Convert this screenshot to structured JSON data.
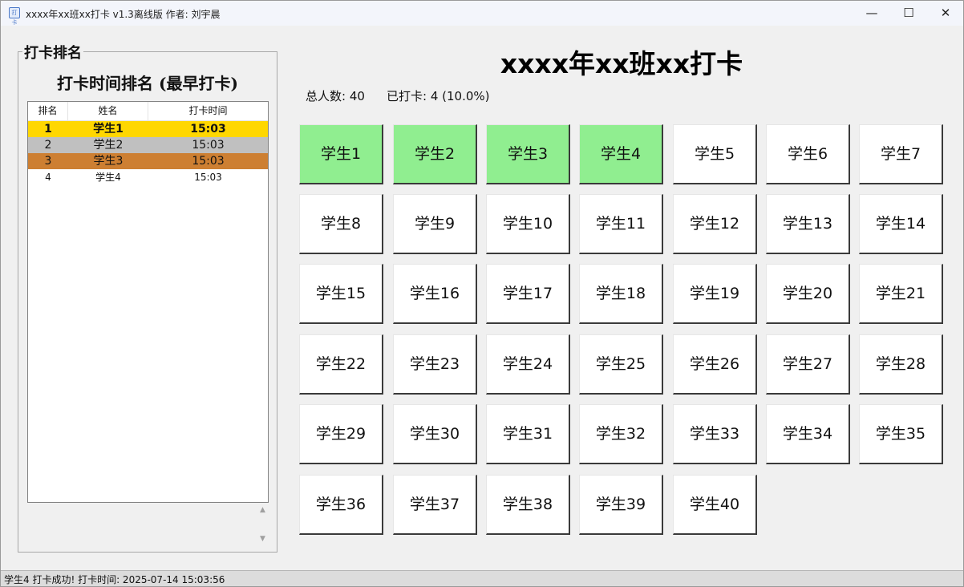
{
  "window": {
    "title": "xxxx年xx班xx打卡 v1.3离线版 作者: 刘宇晨",
    "icon_text": "打卡",
    "min_glyph": "—",
    "max_glyph": "☐",
    "close_glyph": "✕"
  },
  "ranking": {
    "group_label": "打卡排名",
    "title": "打卡时间排名 (最早打卡)",
    "headers": [
      "排名",
      "姓名",
      "打卡时间"
    ],
    "rows": [
      {
        "rank": "1",
        "name": "学生1",
        "time": "15:03",
        "color": "#ffd700"
      },
      {
        "rank": "2",
        "name": "学生2",
        "time": "15:03",
        "color": "#c0c0c0"
      },
      {
        "rank": "3",
        "name": "学生3",
        "time": "15:03",
        "color": "#cd7f32"
      },
      {
        "rank": "4",
        "name": "学生4",
        "time": "15:03",
        "color": "#ffffff"
      }
    ],
    "scroll_up": "▲",
    "scroll_down": "▼"
  },
  "main": {
    "title": "xxxx年xx班xx打卡",
    "total_label": "总人数: 40",
    "checked_label": "已打卡: 4 (10.0%)"
  },
  "students": [
    {
      "name": "学生1",
      "checked": true
    },
    {
      "name": "学生2",
      "checked": true
    },
    {
      "name": "学生3",
      "checked": true
    },
    {
      "name": "学生4",
      "checked": true
    },
    {
      "name": "学生5",
      "checked": false
    },
    {
      "name": "学生6",
      "checked": false
    },
    {
      "name": "学生7",
      "checked": false
    },
    {
      "name": "学生8",
      "checked": false
    },
    {
      "name": "学生9",
      "checked": false
    },
    {
      "name": "学生10",
      "checked": false
    },
    {
      "name": "学生11",
      "checked": false
    },
    {
      "name": "学生12",
      "checked": false
    },
    {
      "name": "学生13",
      "checked": false
    },
    {
      "name": "学生14",
      "checked": false
    },
    {
      "name": "学生15",
      "checked": false
    },
    {
      "name": "学生16",
      "checked": false
    },
    {
      "name": "学生17",
      "checked": false
    },
    {
      "name": "学生18",
      "checked": false
    },
    {
      "name": "学生19",
      "checked": false
    },
    {
      "name": "学生20",
      "checked": false
    },
    {
      "name": "学生21",
      "checked": false
    },
    {
      "name": "学生22",
      "checked": false
    },
    {
      "name": "学生23",
      "checked": false
    },
    {
      "name": "学生24",
      "checked": false
    },
    {
      "name": "学生25",
      "checked": false
    },
    {
      "name": "学生26",
      "checked": false
    },
    {
      "name": "学生27",
      "checked": false
    },
    {
      "name": "学生28",
      "checked": false
    },
    {
      "name": "学生29",
      "checked": false
    },
    {
      "name": "学生30",
      "checked": false
    },
    {
      "name": "学生31",
      "checked": false
    },
    {
      "name": "学生32",
      "checked": false
    },
    {
      "name": "学生33",
      "checked": false
    },
    {
      "name": "学生34",
      "checked": false
    },
    {
      "name": "学生35",
      "checked": false
    },
    {
      "name": "学生36",
      "checked": false
    },
    {
      "name": "学生37",
      "checked": false
    },
    {
      "name": "学生38",
      "checked": false
    },
    {
      "name": "学生39",
      "checked": false
    },
    {
      "name": "学生40",
      "checked": false
    }
  ],
  "colors": {
    "checked": "#90ee90",
    "unchecked": "#ffffff"
  },
  "status": {
    "text": "学生4 打卡成功! 打卡时间: 2025-07-14 15:03:56"
  }
}
